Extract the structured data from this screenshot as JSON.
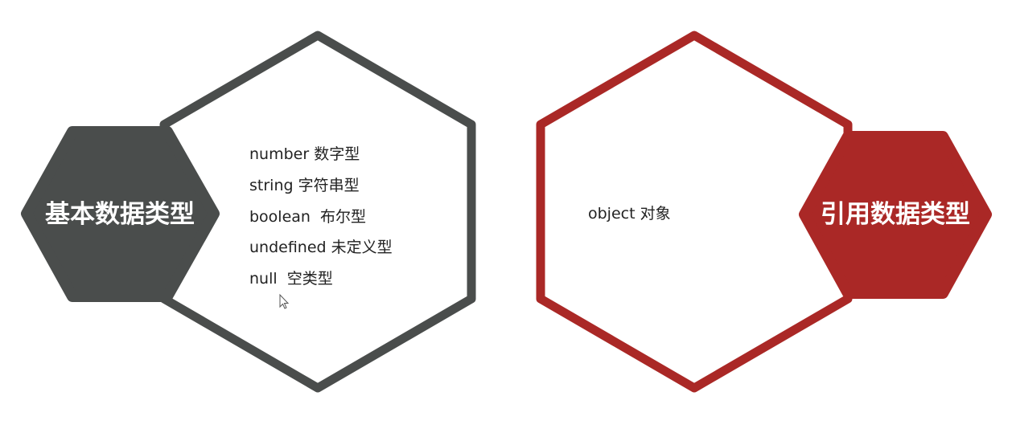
{
  "diagram": {
    "left_group": {
      "label": "基本数据类型",
      "items": [
        "number 数字型",
        "string 字符串型",
        "boolean  布尔型",
        "undefined 未定义型",
        "null  空类型"
      ]
    },
    "right_group": {
      "label": "引用数据类型",
      "items": [
        "object 对象"
      ]
    },
    "colors": {
      "basic": "#4a4d4c",
      "reference": "#aa2826",
      "label_text": "#ffffff",
      "item_text": "#222222",
      "background": "#ffffff"
    }
  }
}
